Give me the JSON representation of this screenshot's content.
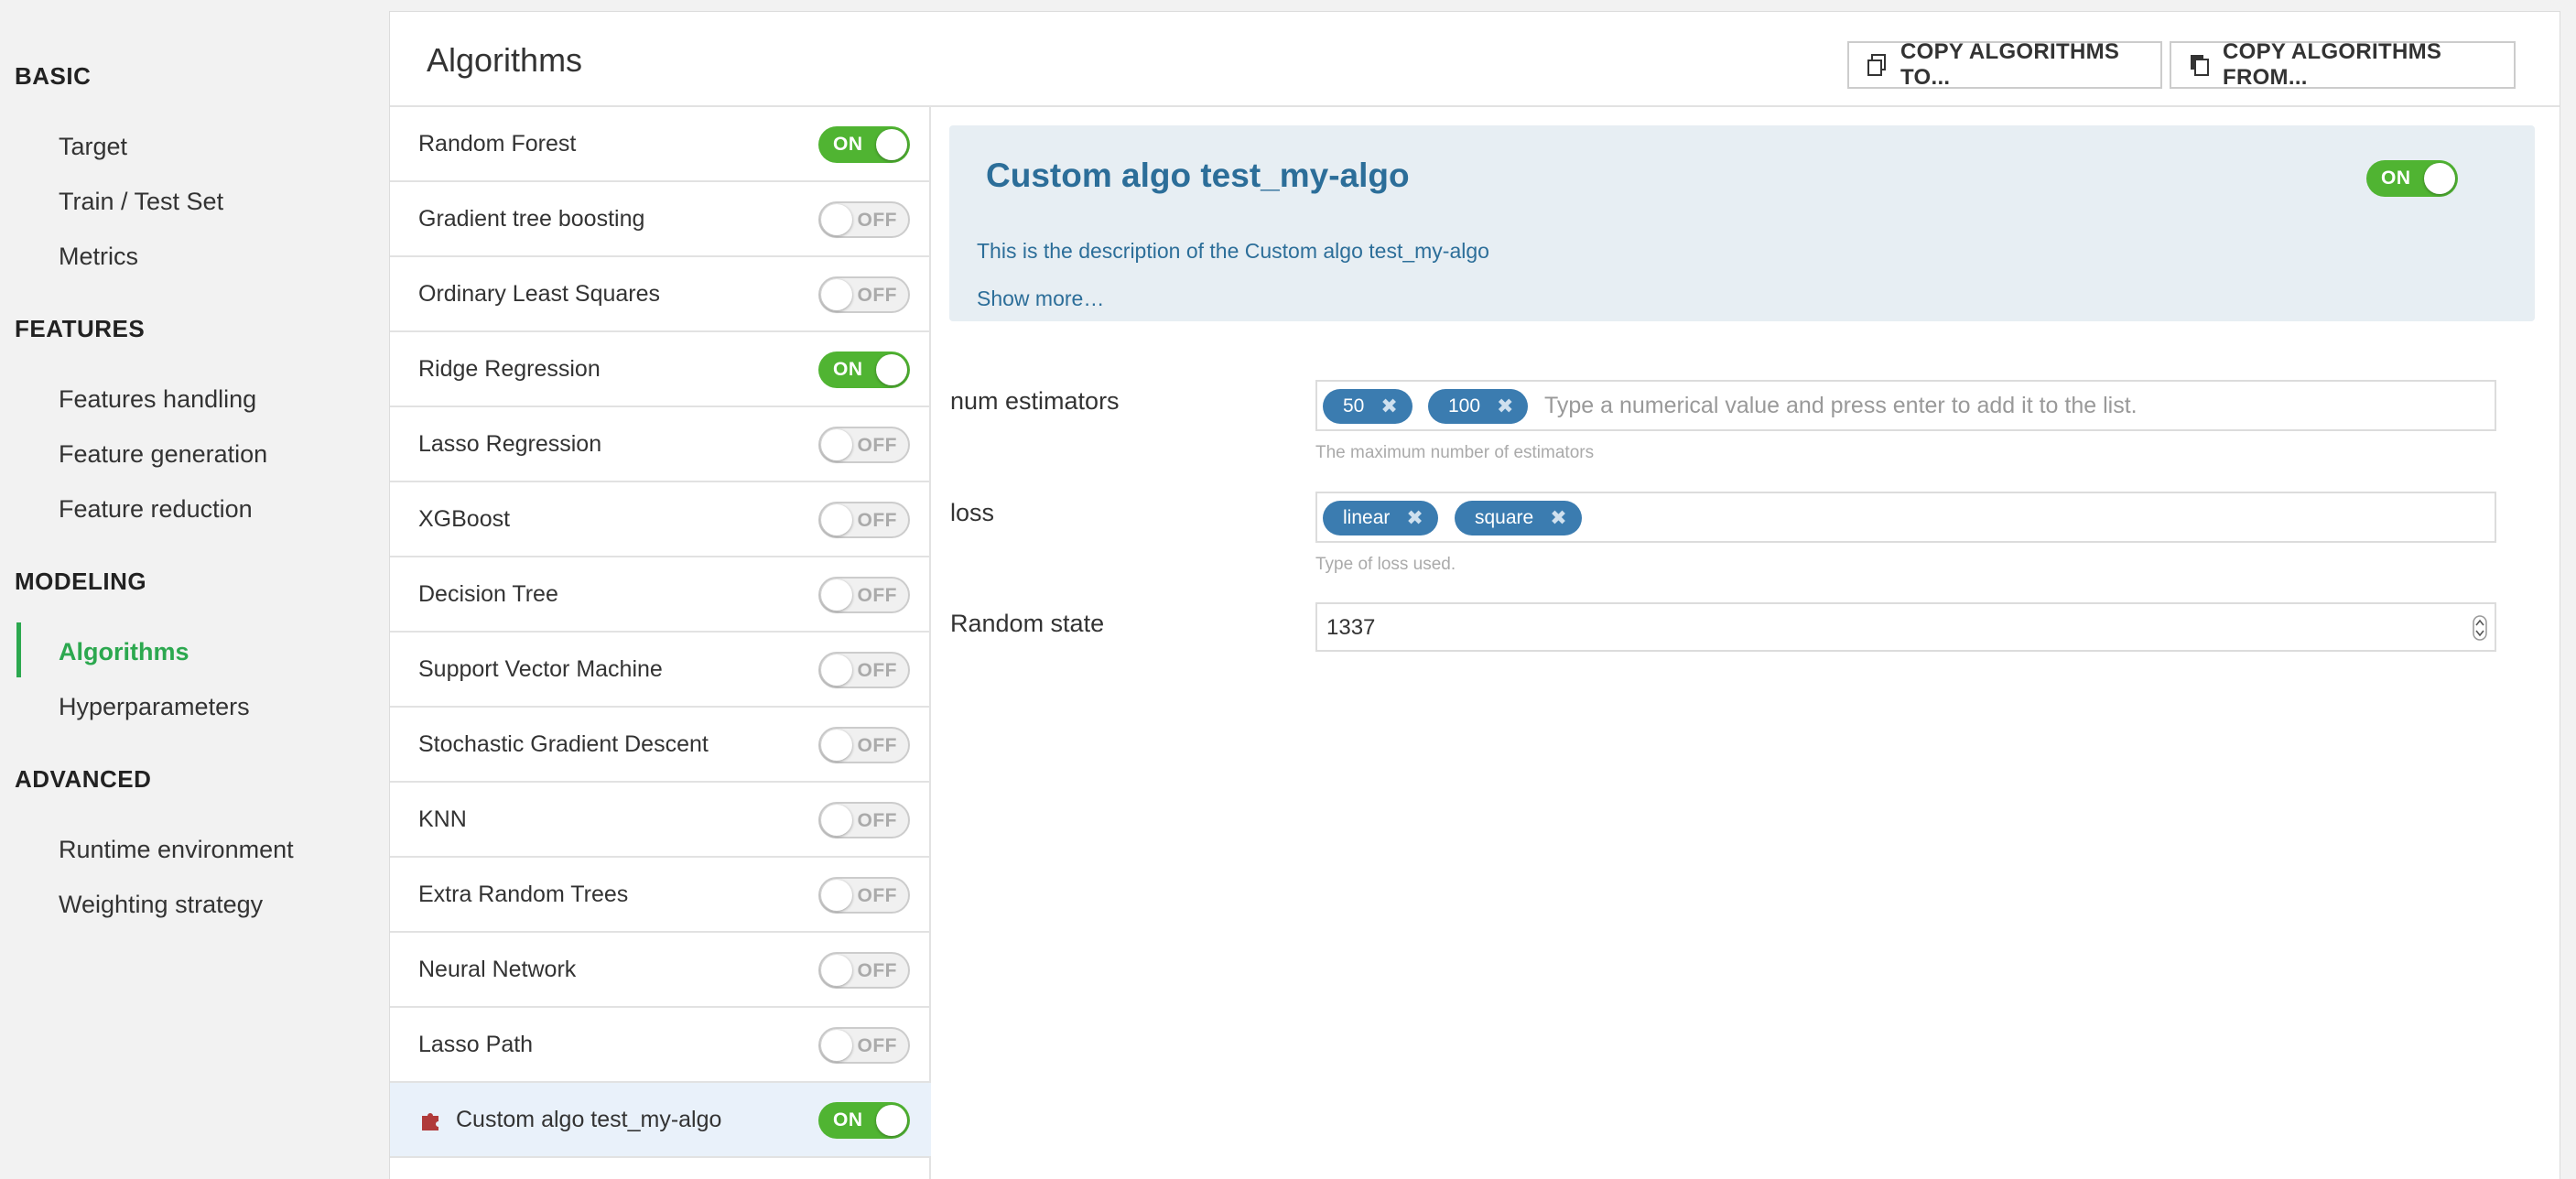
{
  "sidebar": {
    "sections": [
      {
        "title": "BASIC",
        "items": [
          "Target",
          "Train / Test Set",
          "Metrics"
        ]
      },
      {
        "title": "FEATURES",
        "items": [
          "Features handling",
          "Feature generation",
          "Feature reduction"
        ]
      },
      {
        "title": "MODELING",
        "items": [
          "Algorithms",
          "Hyperparameters"
        ]
      },
      {
        "title": "ADVANCED",
        "items": [
          "Runtime environment",
          "Weighting strategy"
        ]
      }
    ],
    "active_item": "Algorithms"
  },
  "header": {
    "title": "Algorithms",
    "copy_to_label": "COPY ALGORITHMS TO...",
    "copy_from_label": "COPY ALGORITHMS FROM..."
  },
  "toggle_labels": {
    "on": "ON",
    "off": "OFF"
  },
  "algorithms": [
    {
      "name": "Random Forest",
      "enabled": true
    },
    {
      "name": "Gradient tree boosting",
      "enabled": false
    },
    {
      "name": "Ordinary Least Squares",
      "enabled": false
    },
    {
      "name": "Ridge Regression",
      "enabled": true
    },
    {
      "name": "Lasso Regression",
      "enabled": false
    },
    {
      "name": "XGBoost",
      "enabled": false
    },
    {
      "name": "Decision Tree",
      "enabled": false
    },
    {
      "name": "Support Vector Machine",
      "enabled": false
    },
    {
      "name": "Stochastic Gradient Descent",
      "enabled": false
    },
    {
      "name": "KNN",
      "enabled": false
    },
    {
      "name": "Extra Random Trees",
      "enabled": false
    },
    {
      "name": "Neural Network",
      "enabled": false
    },
    {
      "name": "Lasso Path",
      "enabled": false
    },
    {
      "name": "Custom algo test_my-algo",
      "enabled": true,
      "selected": true,
      "icon": "puzzle-icon"
    }
  ],
  "detail": {
    "title": "Custom algo test_my-algo",
    "enabled": true,
    "description": "This is the description of the Custom algo test_my-algo",
    "show_more": "Show more…",
    "params": {
      "num_estimators": {
        "label": "num estimators",
        "values": [
          "50",
          "100"
        ],
        "placeholder": "Type a numerical value and press enter to add it to the list.",
        "help": "The maximum number of estimators"
      },
      "loss": {
        "label": "loss",
        "values": [
          "linear",
          "square"
        ],
        "help": "Type of loss used."
      },
      "random_state": {
        "label": "Random state",
        "value": "1337"
      }
    }
  },
  "colors": {
    "accent_green": "#2ca84f",
    "toggle_on": "#50b432",
    "chip_blue": "#3b7cb0",
    "info_blue": "#2c6e99"
  }
}
